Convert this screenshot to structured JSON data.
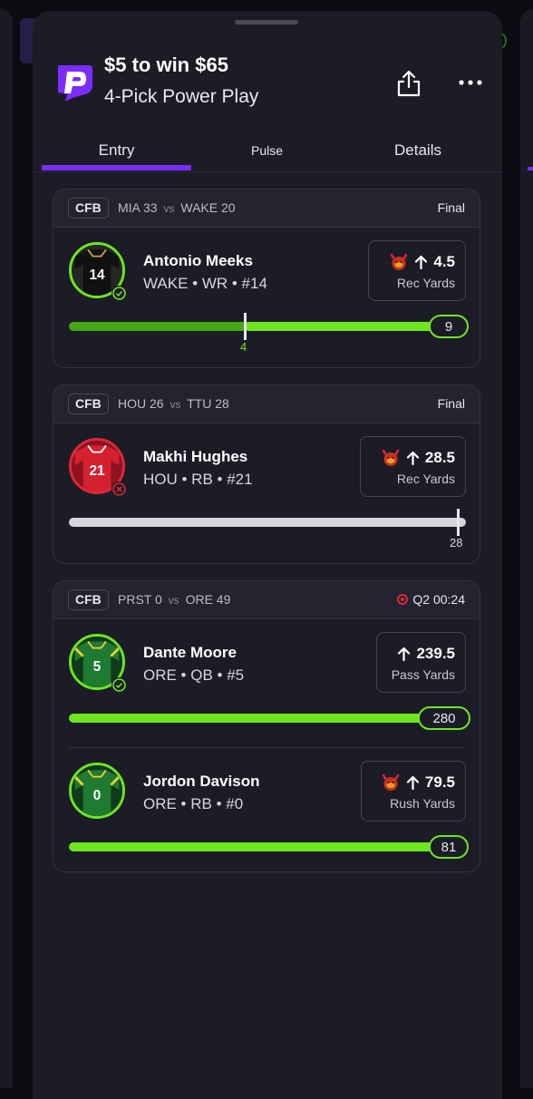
{
  "header": {
    "title": "$5 to win $65",
    "subtitle": "4-Pick Power Play"
  },
  "tabs": [
    {
      "label": "Entry",
      "active": true
    },
    {
      "label": "Pulse",
      "active": false
    },
    {
      "label": "Details",
      "active": false
    }
  ],
  "colors": {
    "accent": "#7b2cff",
    "hit": "#6ee61f",
    "miss": "#e0273a",
    "sheet_bg": "#1b1c26"
  },
  "games": [
    {
      "league": "CFB",
      "away_team": "MIA",
      "away_score": "33",
      "vs": "vs",
      "home_team": "WAKE",
      "home_score": "20",
      "status": "Final",
      "picks": [
        {
          "name": "Antonio Meeks",
          "info": "WAKE • WR • #14",
          "jersey_number": "14",
          "result": "hit",
          "line": "4.5",
          "stat": "Rec Yards",
          "direction": "up",
          "boosted": true,
          "current": "9",
          "marker_label": "4",
          "progress_to_pill": 1.0
        }
      ]
    },
    {
      "league": "CFB",
      "away_team": "HOU",
      "away_score": "26",
      "vs": "vs",
      "home_team": "TTU",
      "home_score": "28",
      "status": "Final",
      "picks": [
        {
          "name": "Makhi Hughes",
          "info": "HOU • RB • #21",
          "jersey_number": "21",
          "result": "miss",
          "line": "28.5",
          "stat": "Rec Yards",
          "direction": "up",
          "boosted": true,
          "current": "",
          "marker_label": "28",
          "progress_to_pill": 1.0
        }
      ]
    },
    {
      "league": "CFB",
      "away_team": "PRST",
      "away_score": "0",
      "vs": "vs",
      "home_team": "ORE",
      "home_score": "49",
      "status": "Q2 00:24",
      "live": true,
      "picks": [
        {
          "name": "Dante Moore",
          "info": "ORE • QB • #5",
          "jersey_number": "5",
          "result": "hit",
          "line": "239.5",
          "stat": "Pass Yards",
          "direction": "up",
          "boosted": false,
          "current": "280",
          "progress_to_pill": 1.0
        },
        {
          "name": "Jordon Davison",
          "info": "ORE • RB • #0",
          "jersey_number": "0",
          "result": "pending",
          "line": "79.5",
          "stat": "Rush Yards",
          "direction": "up",
          "boosted": true,
          "current": "81",
          "progress_to_pill": 1.0
        }
      ]
    }
  ]
}
